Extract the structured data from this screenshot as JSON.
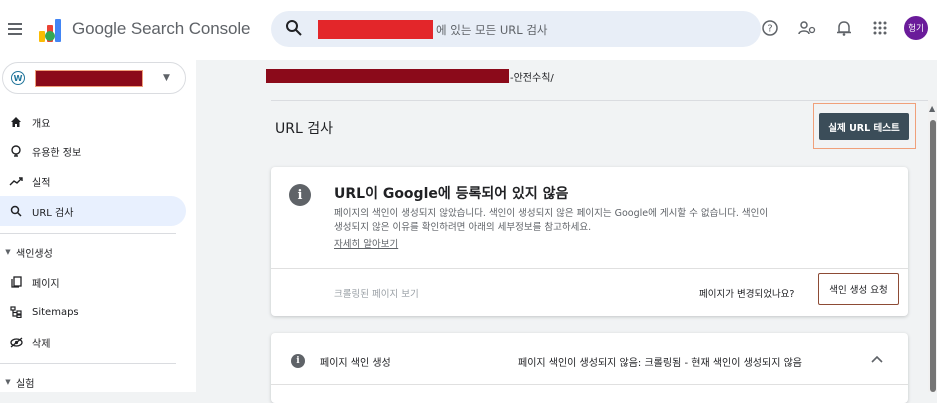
{
  "app": {
    "title": "Google Search Console",
    "avatar_text": "헝기"
  },
  "search": {
    "placeholder": "에 있는 모든 URL 검사"
  },
  "header_icons": [
    "help-icon",
    "manage-users-icon",
    "notifications-icon",
    "apps-grid-icon"
  ],
  "sidebar": {
    "property_icon": "W",
    "items": [
      {
        "label": "개요",
        "icon": "home-icon"
      },
      {
        "label": "유용한 정보",
        "icon": "lightbulb-icon"
      },
      {
        "label": "실적",
        "icon": "trending-icon"
      },
      {
        "label": "URL 검사",
        "icon": "search-icon",
        "active": true
      }
    ],
    "section_indexing": "색인생성",
    "indexing_items": [
      {
        "label": "페이지",
        "icon": "pages-icon"
      },
      {
        "label": "Sitemaps",
        "icon": "sitemap-icon"
      },
      {
        "label": "삭제",
        "icon": "removals-icon"
      }
    ],
    "section_experience": "실험"
  },
  "breadcrumb": {
    "suffix": "-안전수칙/"
  },
  "main": {
    "title": "URL 검사",
    "test_live_button": "실제 URL 테스트",
    "status": {
      "title": "URL이 Google에 등록되어 있지 않음",
      "description": "페이지의 색인이 생성되지 않았습니다. 색인이 생성되지 않은 페이지는 Google에 게시할 수 없습니다. 색인이 생성되지 않은 이유를 확인하려면 아래의 세부정보를 참고하세요.",
      "learn_more": "자세히 알아보기",
      "view_crawled": "크롤링된 페이지 보기",
      "changed_question": "페이지가 변경되었나요?",
      "request_indexing": "색인 생성 요청"
    },
    "indexing": {
      "label": "페이지 색인 생성",
      "value": "페이지 색인이 생성되지 않음: 크롤링됨 - 현재 색인이 생성되지 않음"
    }
  },
  "colors": {
    "accent": "#1a73e8",
    "button_dark": "#3b4d59",
    "redaction_red": "#e3262a",
    "redaction_maroon": "#8b0a1a",
    "highlight_orange": "#f0a07a"
  }
}
